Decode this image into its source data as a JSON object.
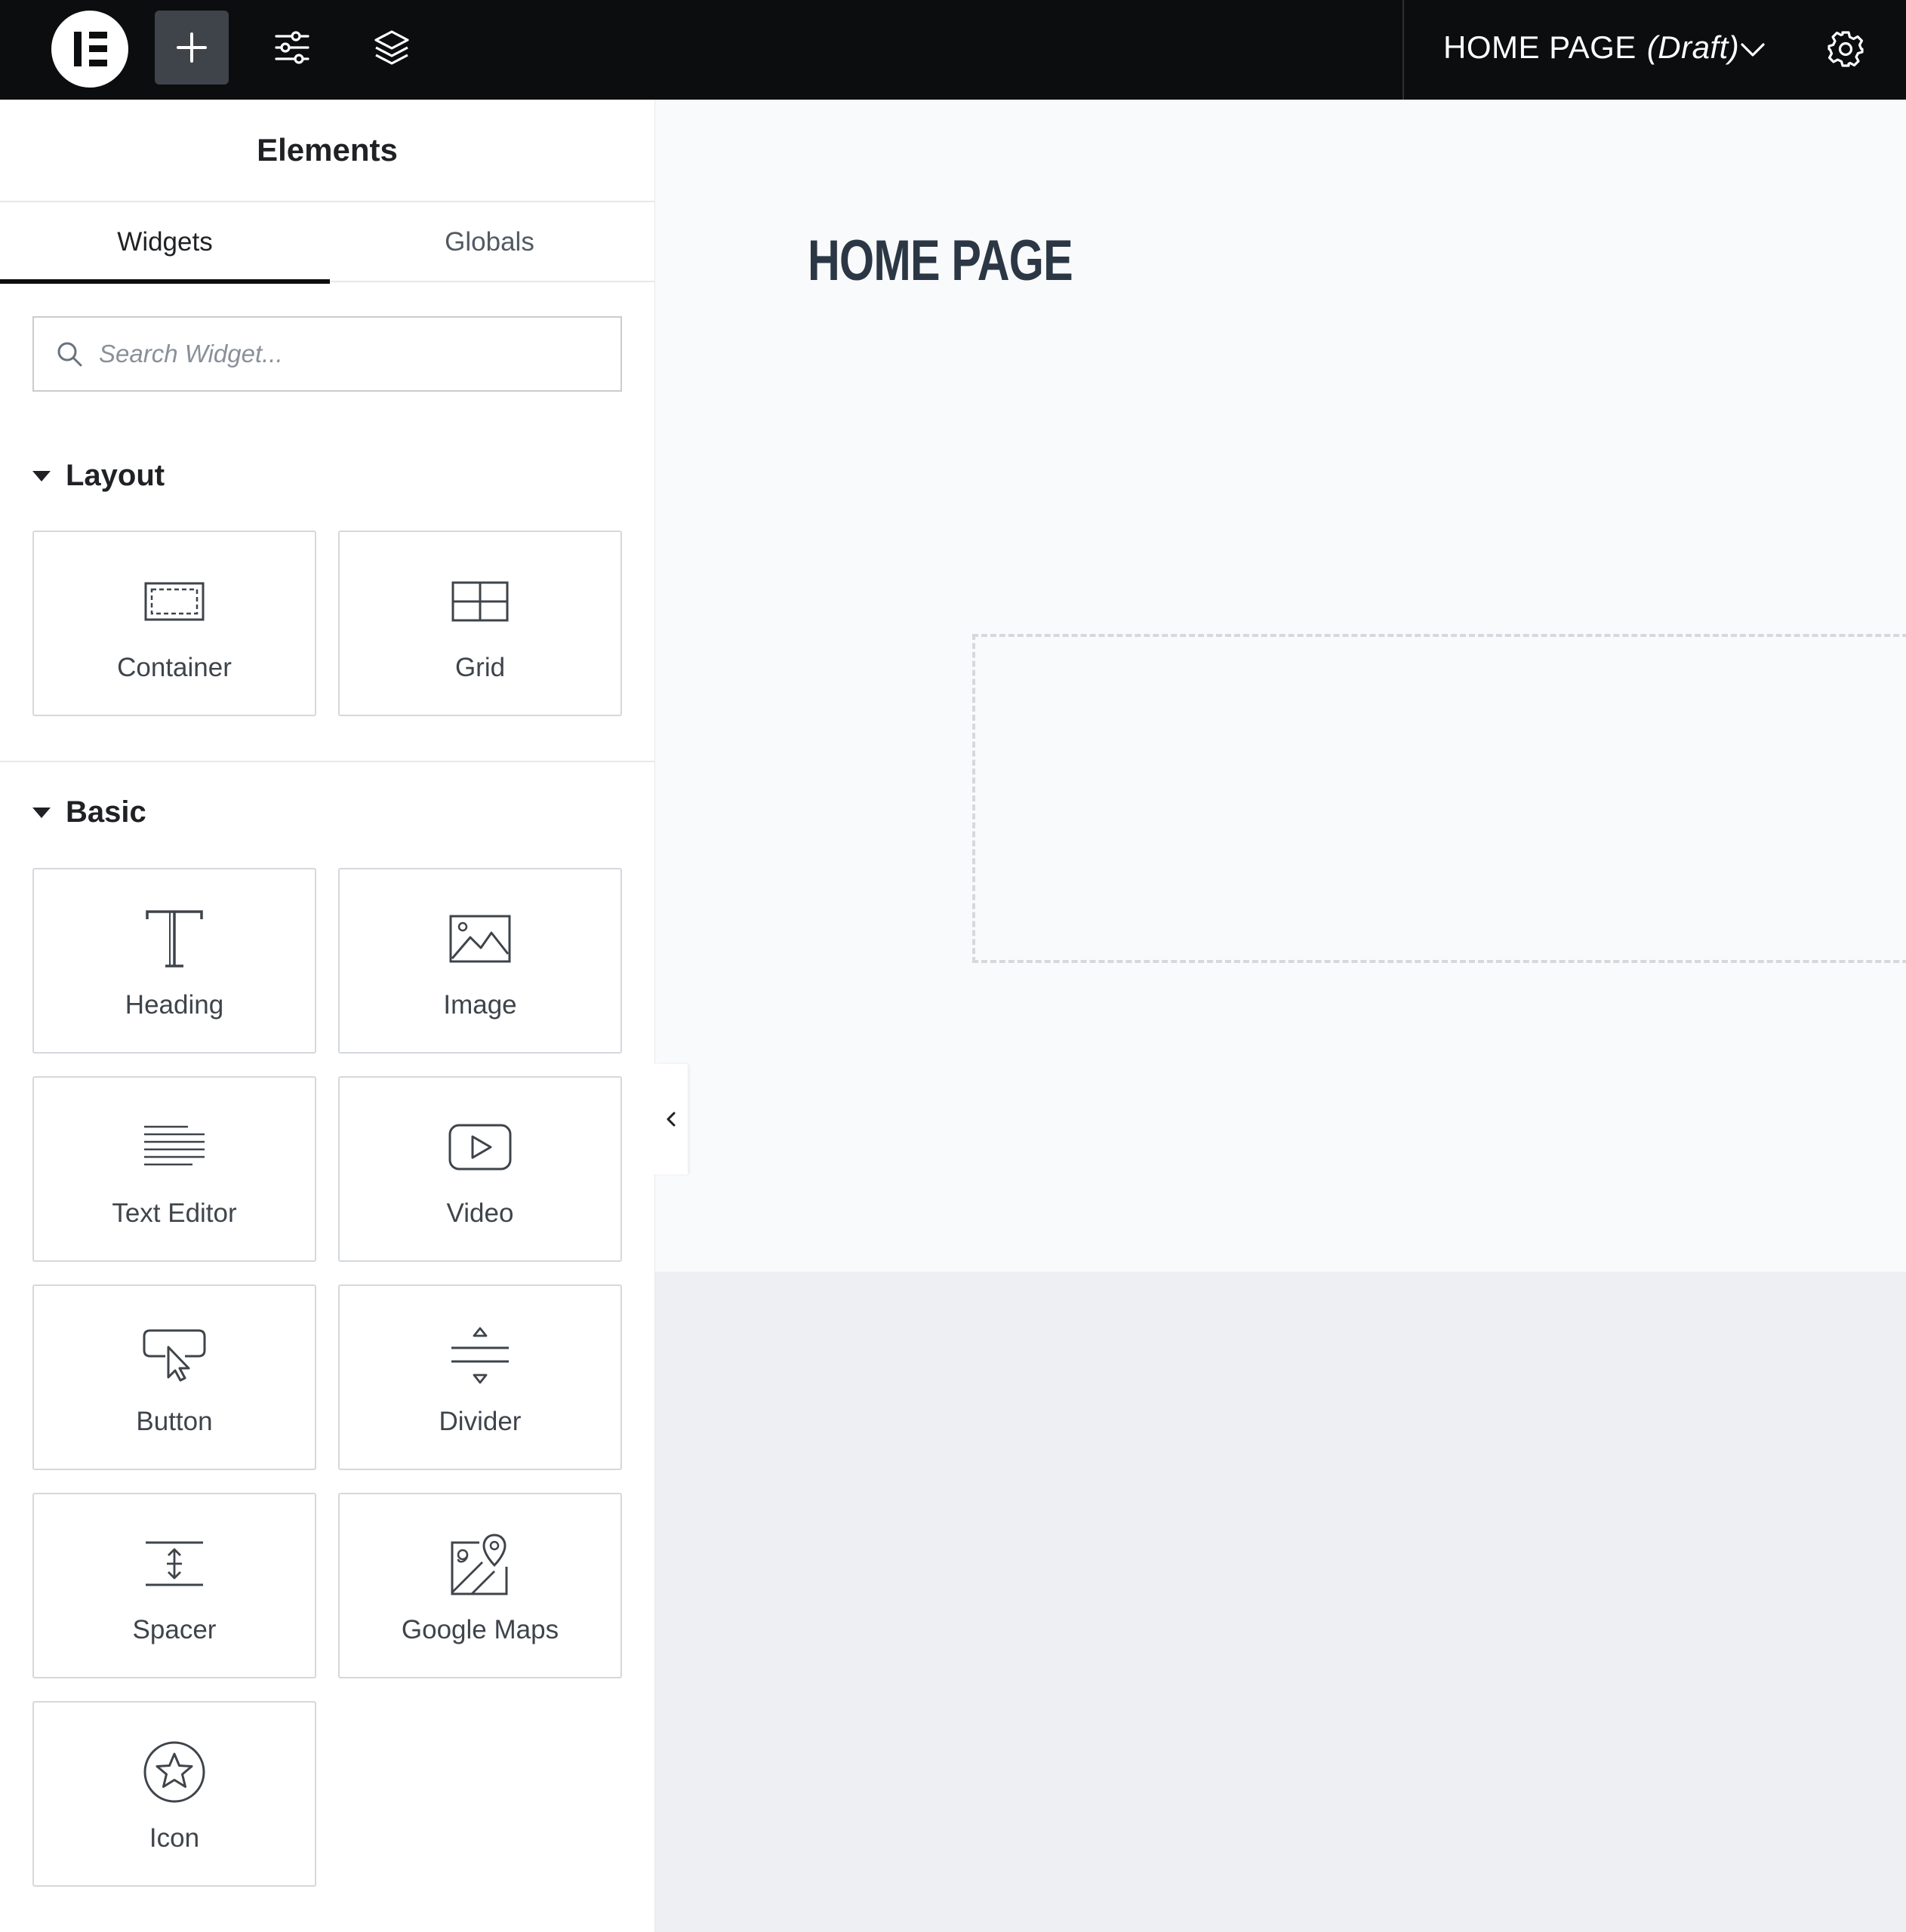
{
  "topbar": {
    "document_name": "HOME PAGE",
    "document_status": "(Draft)",
    "icons": [
      "elementor-logo-icon",
      "plus-icon",
      "sliders-icon",
      "layers-icon",
      "chevron-down-icon",
      "gear-icon"
    ]
  },
  "panel": {
    "title": "Elements",
    "tabs": [
      {
        "label": "Widgets",
        "active": true
      },
      {
        "label": "Globals",
        "active": false
      }
    ],
    "search": {
      "placeholder": "Search Widget...",
      "value": ""
    }
  },
  "sections": {
    "layout": {
      "title": "Layout",
      "widgets": [
        {
          "label": "Container",
          "icon": "container-icon"
        },
        {
          "label": "Grid",
          "icon": "grid-icon"
        }
      ]
    },
    "basic": {
      "title": "Basic",
      "widgets": [
        {
          "label": "Heading",
          "icon": "heading-icon"
        },
        {
          "label": "Image",
          "icon": "image-icon"
        },
        {
          "label": "Text Editor",
          "icon": "text-editor-icon"
        },
        {
          "label": "Video",
          "icon": "video-icon"
        },
        {
          "label": "Button",
          "icon": "button-icon"
        },
        {
          "label": "Divider",
          "icon": "divider-icon"
        },
        {
          "label": "Spacer",
          "icon": "spacer-icon"
        },
        {
          "label": "Google Maps",
          "icon": "google-maps-icon"
        },
        {
          "label": "Icon",
          "icon": "star-icon"
        }
      ]
    }
  },
  "canvas": {
    "page_heading": "HOME PAGE"
  },
  "colors": {
    "topbar_bg": "#0c0d0e",
    "canvas_bg": "#f9fafb",
    "heading_color": "#2c3745",
    "tile_border": "#d5d8dc"
  }
}
